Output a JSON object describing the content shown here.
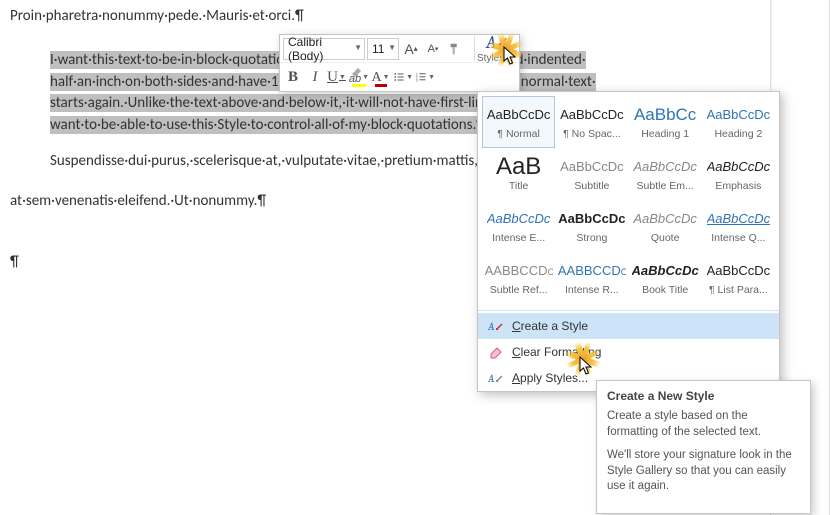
{
  "document": {
    "line1": "Proin·pharetra·nonummy·pede.·Mauris·et·orci.¶",
    "block_l1": "I·want·this·text·to·be·in·block·quotation·formatting.·It·will·be·left·justified·and·indented·",
    "block_l2": "half·an·inch·on·both·sides·and·have·12·points·of·space·beneath·it·before·the·normal·text·",
    "block_l3": "starts·again.·Unlike·the·text·above·and·below·it,·it·will·not·have·first-line·indentation.·I·",
    "block_l4": "want·to·be·able·to·use·this·Style·to·control·all·of·my·block·quotations.¶",
    "after1": "Suspendisse·dui·purus,·scelerisque·at,·vulputate·vitae,·pretium·mattis,·nunc.·Mauris·eget·neque·",
    "after2": "at·sem·venenatis·eleifend.·Ut·nonummy.¶",
    "lone_pilcrow": "¶"
  },
  "mini_toolbar": {
    "font": "Calibri (Body)",
    "size": "11",
    "grow": "A",
    "shrink": "A",
    "bold": "B",
    "italic": "I",
    "underline": "U",
    "highlight": "ab",
    "fontcolor": "A",
    "styles_icon": "A",
    "styles_label": "Styles"
  },
  "styles": {
    "grid": [
      {
        "preview": "AaBbCcDc",
        "label": "¶ Normal",
        "css": "color:#222;"
      },
      {
        "preview": "AaBbCcDc",
        "label": "¶ No Spac...",
        "css": "color:#222;"
      },
      {
        "preview": "AaBbCc",
        "label": "Heading 1",
        "css": "color:#2e74b5;font-size:17px;"
      },
      {
        "preview": "AaBbCcDc",
        "label": "Heading 2",
        "css": "color:#2e74b5;"
      },
      {
        "preview": "AaB",
        "label": "Title",
        "css": "color:#222;font-size:24px;"
      },
      {
        "preview": "AaBbCcDc",
        "label": "Subtitle",
        "css": "color:#888;"
      },
      {
        "preview": "AaBbCcDc",
        "label": "Subtle Em...",
        "css": "color:#888;font-style:italic;"
      },
      {
        "preview": "AaBbCcDc",
        "label": "Emphasis",
        "css": "color:#222;font-style:italic;"
      },
      {
        "preview": "AaBbCcDc",
        "label": "Intense E...",
        "css": "color:#2e74b5;font-style:italic;"
      },
      {
        "preview": "AaBbCcDc",
        "label": "Strong",
        "css": "color:#222;font-weight:bold;"
      },
      {
        "preview": "AaBbCcDc",
        "label": "Quote",
        "css": "color:#888;font-style:italic;"
      },
      {
        "preview": "AaBbCcDc",
        "label": "Intense Q...",
        "css": "color:#2e74b5;font-style:italic;text-decoration:underline;"
      },
      {
        "preview": "AABBCCDc",
        "label": "Subtle Ref...",
        "css": "color:#888;font-variant:small-caps;"
      },
      {
        "preview": "AABBCCDc",
        "label": "Intense R...",
        "css": "color:#2e74b5;font-variant:small-caps;"
      },
      {
        "preview": "AaBbCcDc",
        "label": "Book Title",
        "css": "color:#222;font-style:italic;font-weight:bold;"
      },
      {
        "preview": "AaBbCcDc",
        "label": "¶ List Para...",
        "css": "color:#222;"
      }
    ],
    "selected_index": 0,
    "menu": {
      "create": "Create a Style",
      "clear": "Clear Formatting",
      "apply": "Apply Styles..."
    }
  },
  "tooltip": {
    "title": "Create a New Style",
    "p1": "Create a style based on the formatting of the selected text.",
    "p2": "We'll store your signature look in the Style Gallery so that you can easily use it again."
  }
}
